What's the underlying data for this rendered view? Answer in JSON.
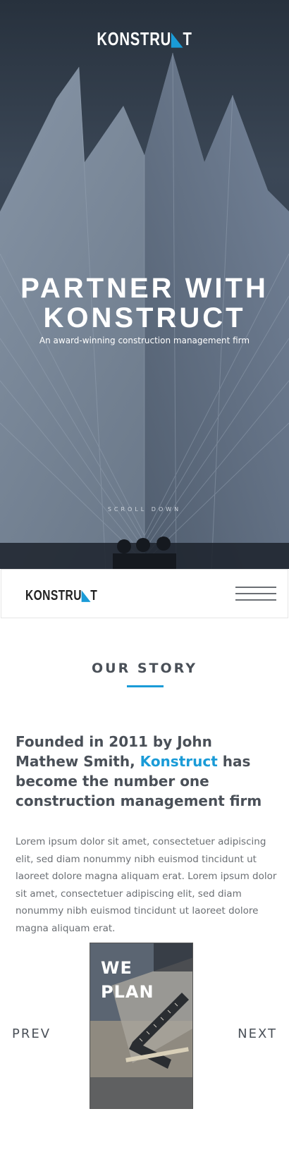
{
  "hero": {
    "logo_main": "KONSTRU",
    "logo_accent": "◣",
    "logo_end": "T",
    "title_line1": "PARTNER WITH",
    "title_line2": "KONSTRUCT",
    "subtitle": "An award-winning construction management firm",
    "scroll_label": "SCROLL DOWN"
  },
  "navbar": {
    "logo_main": "KONSTRU",
    "logo_accent": "◣",
    "logo_end": "T",
    "menu_icon": "hamburger-menu-icon"
  },
  "story": {
    "section_title": "OUR STORY",
    "heading_before": "Founded in 2011 by John Mathew Smith, ",
    "heading_brand": "Konstruct",
    "heading_after": " has become the number one construction management firm",
    "body": "Lorem ipsum dolor sit amet, consectetuer adipiscing elit, sed diam nonummy nibh euismod tincidunt ut laoreet dolore magna aliquam erat. Lorem ipsum dolor sit amet, consectetuer adipiscing elit, sed diam nonummy nibh euismod tincidunt ut laoreet dolore magna aliquam erat."
  },
  "slider": {
    "prev_label": "PREV",
    "next_label": "NEXT",
    "slide_line1": "WE",
    "slide_line2": "PLAN"
  },
  "colors": {
    "accent": "#1a9bd7",
    "heading": "#4a5058",
    "body_text": "#6b6f74"
  }
}
